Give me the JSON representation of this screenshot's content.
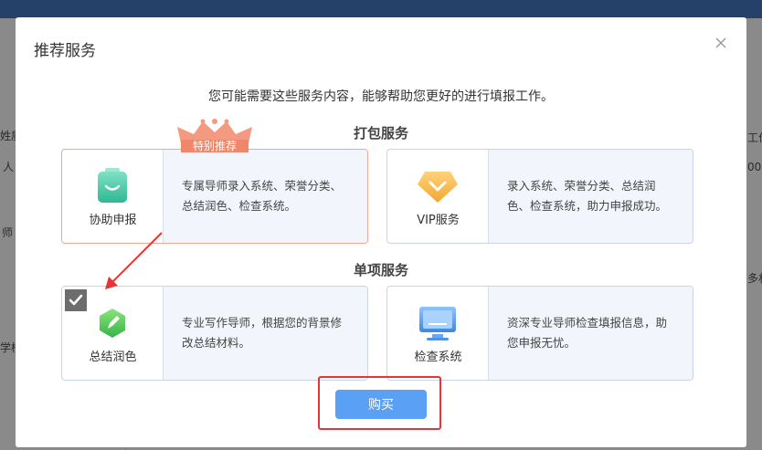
{
  "background": {
    "texts": [
      "姓质",
      "人",
      "00",
      "师",
      "工作",
      "多村",
      "学校"
    ]
  },
  "modal": {
    "title": "推荐服务",
    "subtitle": "您可能需要这些服务内容，能够帮助您更好的进行填报工作。",
    "package_section_title": "打包服务",
    "single_section_title": "单项服务",
    "badge_text": "特别推荐",
    "buy_label": "购买"
  },
  "cards": {
    "assist": {
      "label": "协助申报",
      "desc": "专属导师录入系统、荣誉分类、总结润色、检查系统。",
      "icon": "bag-icon",
      "color": "#3cc6a6"
    },
    "vip": {
      "label": "VIP服务",
      "desc": "录入系统、荣誉分类、总结润色、检查系统，助力申报成功。",
      "icon": "diamond-chevron-icon",
      "color": "#f5b545"
    },
    "polish": {
      "label": "总结润色",
      "desc": "专业写作导师，根据您的背景修改总结材料。",
      "icon": "pencil-icon",
      "color": "#4cc15a",
      "checked": true
    },
    "check": {
      "label": "检查系统",
      "desc": "资深专业导师检查填报信息，助您申报无忧。",
      "icon": "monitor-icon",
      "color": "#4a90e2"
    }
  },
  "colors": {
    "accent": "#5aa0f5",
    "highlight": "#e53535",
    "badge": "#f0876b"
  }
}
